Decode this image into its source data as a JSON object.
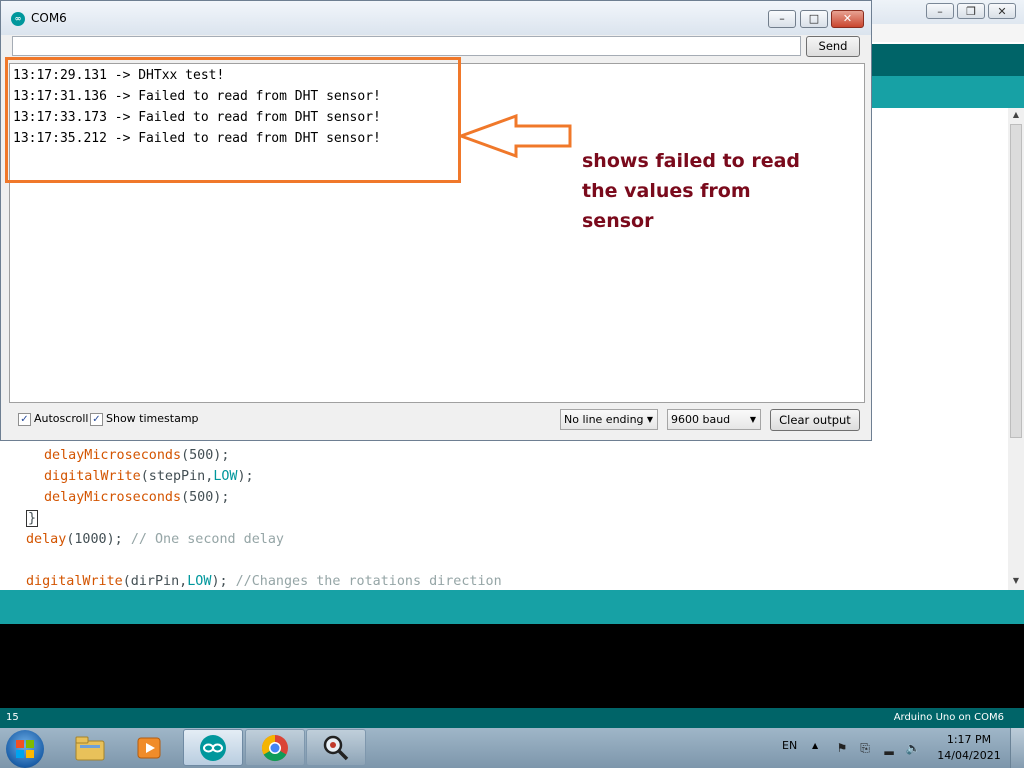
{
  "ide": {
    "code_lines": [
      {
        "a": "delayMicroseconds",
        "b": "(500);",
        "c": "",
        "d": "",
        "e": ""
      },
      {
        "a": "digitalWrite",
        "b": "(stepPin,",
        "c": "LOW",
        "d": ");",
        "e": ""
      },
      {
        "a": "delayMicroseconds",
        "b": "(500);",
        "c": "",
        "d": "",
        "e": ""
      },
      {
        "brace": "}"
      },
      {
        "a": "delay",
        "b": "(1000); ",
        "c": "",
        "d": "",
        "e": "// One second delay"
      },
      {
        "a": "digitalWrite",
        "b": "(dirPin,",
        "c": "LOW",
        "d": "); ",
        "e": "//Changes the rotations direction"
      }
    ],
    "footer": {
      "line_number": "15",
      "board": "Arduino Uno on COM6"
    }
  },
  "serial": {
    "title": "COM6",
    "send_label": "Send",
    "send_value": "",
    "output_lines": [
      "13:17:29.131 -> DHTxx test!",
      "13:17:31.136 -> Failed to read from DHT sensor!",
      "13:17:33.173 -> Failed to read from DHT sensor!",
      "13:17:35.212 -> Failed to read from DHT sensor!"
    ],
    "autoscroll_label": "Autoscroll",
    "autoscroll_checked": true,
    "timestamp_label": "Show timestamp",
    "timestamp_checked": true,
    "line_ending": "No line ending",
    "baud": "9600 baud",
    "clear_label": "Clear output"
  },
  "annotation": {
    "line1": "shows failed to read",
    "line2": "the values from",
    "line3": "sensor",
    "color": "#7a0a1c",
    "box_color": "#f0782a"
  },
  "taskbar": {
    "apps": [
      "explorer-icon",
      "media-player-icon",
      "arduino-icon",
      "chrome-icon",
      "magnifier-icon"
    ],
    "active_app": "arduino-icon",
    "language": "EN",
    "time": "1:17 PM",
    "date": "14/04/2021"
  }
}
